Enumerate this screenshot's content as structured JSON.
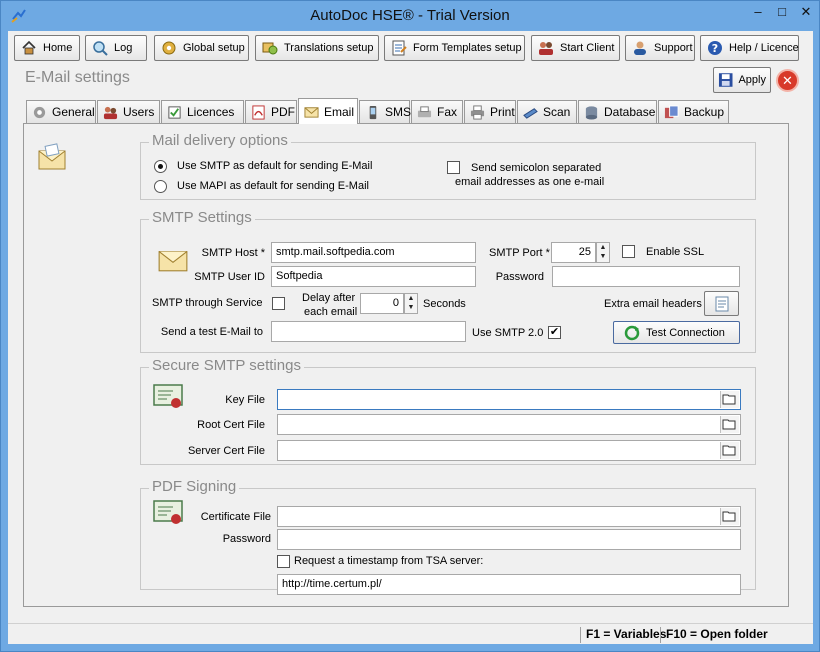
{
  "window": {
    "title": "AutoDoc HSE® - Trial Version"
  },
  "toolbar": {
    "home": "Home",
    "log": "Log",
    "global_setup": "Global setup",
    "translations_setup": "Translations setup",
    "form_templates_setup": "Form Templates setup",
    "start_client": "Start Client",
    "support": "Support",
    "help_licence": "Help / Licence"
  },
  "page": {
    "title": "E-Mail settings",
    "apply_label": "Apply"
  },
  "tabs": [
    "General",
    "Users",
    "Licences",
    "PDF",
    "Email",
    "SMS",
    "Fax",
    "Print",
    "Scan",
    "Database",
    "Backup"
  ],
  "active_tab": "Email",
  "mail_delivery": {
    "title": "Mail delivery options",
    "use_smtp_label": "Use SMTP as default for sending E-Mail",
    "use_smtp_selected": true,
    "use_mapi_label": "Use MAPI as default for sending E-Mail",
    "use_mapi_selected": false,
    "semicolon_label_1": "Send semicolon separated",
    "semicolon_label_2": "email addresses as one e-mail",
    "semicolon_checked": false
  },
  "smtp": {
    "title": "SMTP Settings",
    "host_label": "SMTP Host *",
    "host_value": "smtp.mail.softpedia.com",
    "port_label": "SMTP Port *",
    "port_value": "25",
    "ssl_label": "Enable SSL",
    "ssl_checked": false,
    "user_label": "SMTP User ID",
    "user_value": "Softpedia",
    "password_label": "Password",
    "password_value": "",
    "through_service_label": "SMTP through Service",
    "through_service_checked": false,
    "delay_label_1": "Delay after",
    "delay_label_2": "each email",
    "delay_value": "0",
    "seconds_label": "Seconds",
    "extra_headers_label": "Extra email headers",
    "test_email_label": "Send a test E-Mail to",
    "test_email_value": "",
    "use_smtp2_label": "Use SMTP 2.0",
    "use_smtp2_checked": true,
    "test_connection_label": "Test Connection"
  },
  "secure_smtp": {
    "title": "Secure SMTP settings",
    "key_file_label": "Key File",
    "key_file_value": "",
    "root_cert_label": "Root Cert File",
    "root_cert_value": "",
    "server_cert_label": "Server Cert File",
    "server_cert_value": ""
  },
  "pdf_signing": {
    "title": "PDF Signing",
    "certificate_label": "Certificate File",
    "certificate_value": "",
    "password_label": "Password",
    "password_value": "",
    "tsa_label": "Request a timestamp from TSA server:",
    "tsa_checked": false,
    "tsa_url": "http://time.certum.pl/"
  },
  "status": {
    "f1": "F1 = Variables",
    "f10": "F10 = Open folder"
  }
}
